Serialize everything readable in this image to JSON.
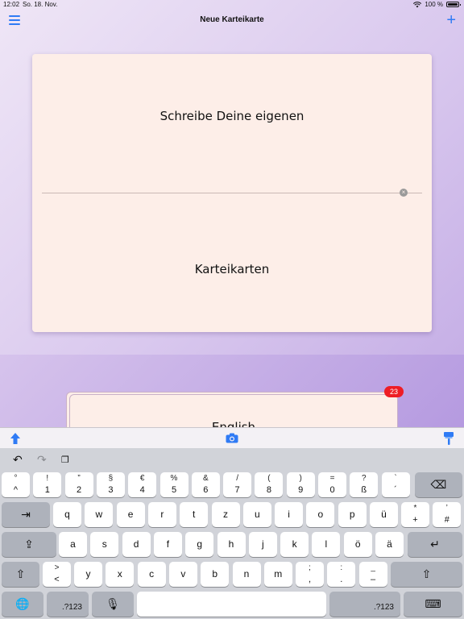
{
  "status": {
    "time": "12:02",
    "date": "So. 18. Nov.",
    "battery": "100 %"
  },
  "nav": {
    "title": "Neue Karteikarte",
    "add_label": "+"
  },
  "card": {
    "front_text": "Schreibe Deine eigenen",
    "back_text": "Karteikarten",
    "clear_label": "×"
  },
  "stack": {
    "label": "English",
    "badge": "23"
  },
  "shortcuts": {
    "undo": "↶",
    "redo": "↷",
    "paste": "❐"
  },
  "keys": {
    "row1": [
      {
        "top": "°",
        "bottom": "^"
      },
      {
        "top": "!",
        "bottom": "1"
      },
      {
        "top": "”",
        "bottom": "2"
      },
      {
        "top": "§",
        "bottom": "3"
      },
      {
        "top": "€",
        "bottom": "4"
      },
      {
        "top": "%",
        "bottom": "5"
      },
      {
        "top": "&",
        "bottom": "6"
      },
      {
        "top": "/",
        "bottom": "7"
      },
      {
        "top": "(",
        "bottom": "8"
      },
      {
        "top": ")",
        "bottom": "9"
      },
      {
        "top": "=",
        "bottom": "0"
      },
      {
        "top": "?",
        "bottom": "ß"
      },
      {
        "top": "`",
        "bottom": "´"
      }
    ],
    "backspace": "⌫",
    "tab": "⇥",
    "row2": [
      "q",
      "w",
      "e",
      "r",
      "t",
      "z",
      "u",
      "i",
      "o",
      "p",
      "ü"
    ],
    "row2_special": [
      {
        "top": "*",
        "bottom": "+"
      },
      {
        "top": "’",
        "bottom": "#"
      }
    ],
    "capslock": "⇪",
    "row3": [
      "a",
      "s",
      "d",
      "f",
      "g",
      "h",
      "j",
      "k",
      "l",
      "ö",
      "ä"
    ],
    "return": "↵",
    "shift": "⇧",
    "row4_special_left": {
      "top": ">",
      "bottom": "<"
    },
    "row4": [
      "y",
      "x",
      "c",
      "v",
      "b",
      "n",
      "m"
    ],
    "row4_special": [
      {
        "top": ";",
        "bottom": ","
      },
      {
        "top": ":",
        "bottom": "."
      },
      {
        "top": "_",
        "bottom": "–"
      }
    ],
    "globe": "🌐",
    "numbers": ".?123",
    "mic": "🎙",
    "space": "",
    "hide": "⌨"
  },
  "colors": {
    "accent": "#2f7bf5",
    "badge": "#ee1d25",
    "card": "#fdeee8"
  }
}
